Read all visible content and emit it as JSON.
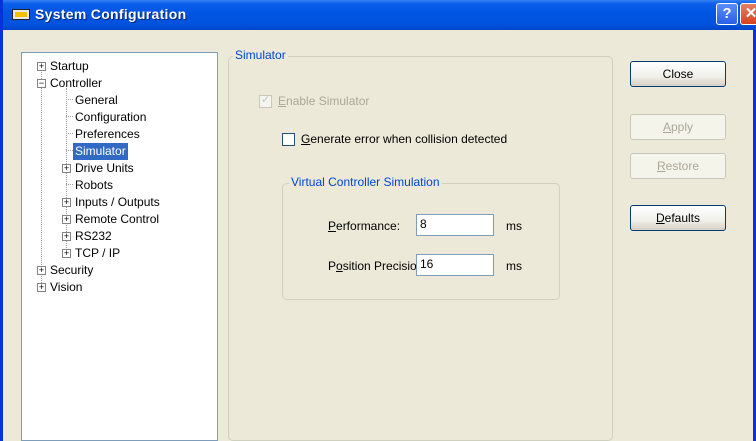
{
  "window": {
    "title": "System Configuration",
    "help_glyph": "?",
    "close_glyph": "✕"
  },
  "tree": {
    "items": [
      {
        "label": "Startup",
        "expander": "+"
      },
      {
        "label": "Controller",
        "expander": "−"
      },
      {
        "label": "General"
      },
      {
        "label": "Configuration"
      },
      {
        "label": "Preferences"
      },
      {
        "label": "Simulator",
        "selected": true
      },
      {
        "label": "Drive Units",
        "expander": "+"
      },
      {
        "label": "Robots"
      },
      {
        "label": "Inputs / Outputs",
        "expander": "+"
      },
      {
        "label": "Remote Control",
        "expander": "+"
      },
      {
        "label": "RS232",
        "expander": "+"
      },
      {
        "label": "TCP / IP",
        "expander": "+"
      },
      {
        "label": "Security",
        "expander": "+"
      },
      {
        "label": "Vision",
        "expander": "+"
      }
    ]
  },
  "simulator": {
    "group_label": "Simulator",
    "enable": {
      "mnemonic": "E",
      "rest": "nable Simulator",
      "checked": true,
      "disabled": true
    },
    "collision": {
      "mnemonic": "G",
      "rest": "enerate error when collision detected",
      "checked": false
    },
    "virtual": {
      "group_label": "Virtual Controller Simulation",
      "performance": {
        "mnemonic": "P",
        "rest": "erformance:",
        "value": "8",
        "unit": "ms"
      },
      "precision": {
        "prefix": "P",
        "mnemonic": "o",
        "rest": "sition Precision:",
        "value": "16",
        "unit": "ms"
      }
    }
  },
  "buttons": {
    "close": "Close",
    "apply": {
      "mnemonic": "A",
      "rest": "pply"
    },
    "restore": {
      "mnemonic": "R",
      "rest": "estore"
    },
    "defaults": {
      "mnemonic": "D",
      "rest": "efaults"
    }
  }
}
